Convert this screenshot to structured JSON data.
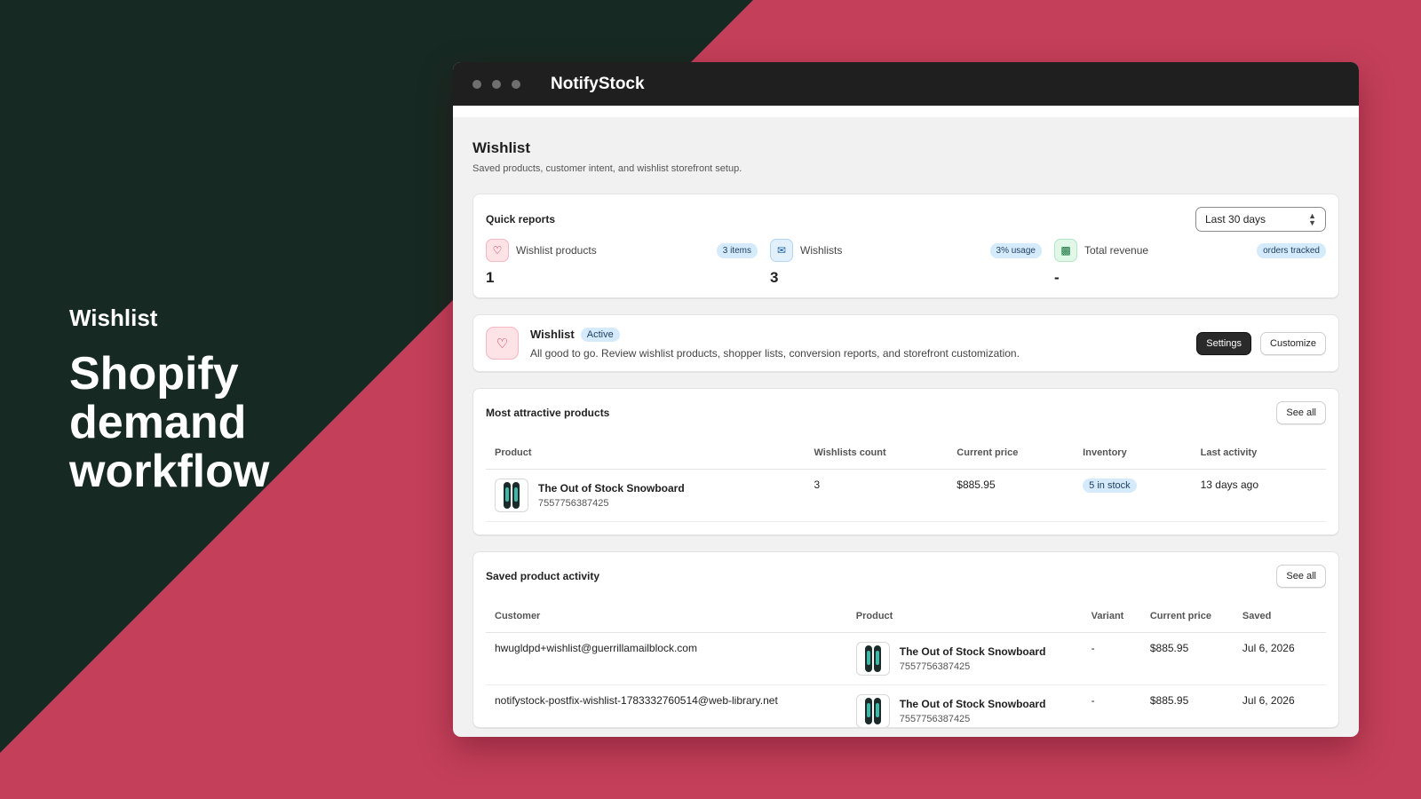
{
  "hero": {
    "eyebrow": "Wishlist",
    "headline": "Shopify demand workflow"
  },
  "window": {
    "app_title": "NotifyStock"
  },
  "page": {
    "title": "Wishlist",
    "subtitle": "Saved products, customer intent, and wishlist storefront setup."
  },
  "quick_reports": {
    "title": "Quick reports",
    "range": "Last 30 days",
    "stats": [
      {
        "icon": "heart-icon",
        "label": "Wishlist products",
        "badge": "3 items",
        "value": "1"
      },
      {
        "icon": "mail-icon",
        "label": "Wishlists",
        "badge": "3% usage",
        "value": "3"
      },
      {
        "icon": "chart-icon",
        "label": "Total revenue",
        "badge": "orders tracked",
        "value": "-"
      }
    ]
  },
  "banner": {
    "title": "Wishlist",
    "status": "Active",
    "description": "All good to go. Review wishlist products, shopper lists, conversion reports, and storefront customization.",
    "settings_label": "Settings",
    "customize_label": "Customize"
  },
  "attractive": {
    "title": "Most attractive products",
    "see_all": "See all",
    "columns": [
      "Product",
      "Wishlists count",
      "Current price",
      "Inventory",
      "Last activity"
    ],
    "rows": [
      {
        "name": "The Out of Stock Snowboard",
        "id": "7557756387425",
        "count": "3",
        "price": "$885.95",
        "inventory": "5 in stock",
        "last_activity": "13 days ago"
      }
    ]
  },
  "activity": {
    "title": "Saved product activity",
    "see_all": "See all",
    "columns": [
      "Customer",
      "Product",
      "Variant",
      "Current price",
      "Saved"
    ],
    "rows": [
      {
        "customer": "hwugldpd+wishlist@guerrillamailblock.com",
        "name": "The Out of Stock Snowboard",
        "id": "7557756387425",
        "variant": "-",
        "price": "$885.95",
        "saved": "Jul 6, 2026"
      },
      {
        "customer": "notifystock-postfix-wishlist-1783332760514@web-library.net",
        "name": "The Out of Stock Snowboard",
        "id": "7557756387425",
        "variant": "-",
        "price": "$885.95",
        "saved": "Jul 6, 2026"
      }
    ]
  }
}
